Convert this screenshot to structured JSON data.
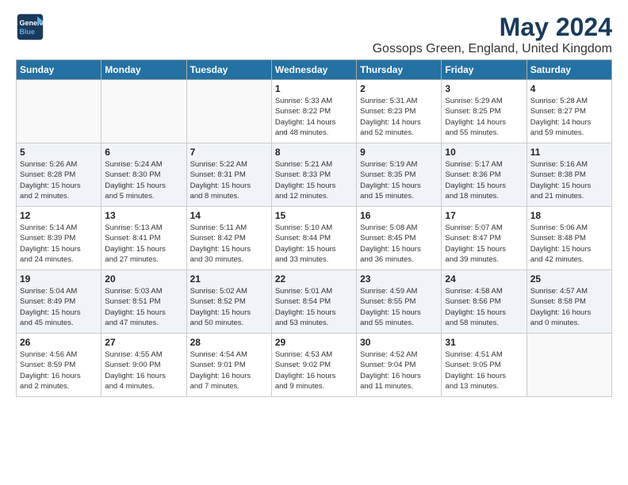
{
  "header": {
    "logo_line1": "General",
    "logo_line2": "Blue",
    "title": "May 2024",
    "subtitle": "Gossops Green, England, United Kingdom"
  },
  "days_of_week": [
    "Sunday",
    "Monday",
    "Tuesday",
    "Wednesday",
    "Thursday",
    "Friday",
    "Saturday"
  ],
  "weeks": [
    [
      {
        "day": "",
        "info": ""
      },
      {
        "day": "",
        "info": ""
      },
      {
        "day": "",
        "info": ""
      },
      {
        "day": "1",
        "info": "Sunrise: 5:33 AM\nSunset: 8:22 PM\nDaylight: 14 hours\nand 48 minutes."
      },
      {
        "day": "2",
        "info": "Sunrise: 5:31 AM\nSunset: 8:23 PM\nDaylight: 14 hours\nand 52 minutes."
      },
      {
        "day": "3",
        "info": "Sunrise: 5:29 AM\nSunset: 8:25 PM\nDaylight: 14 hours\nand 55 minutes."
      },
      {
        "day": "4",
        "info": "Sunrise: 5:28 AM\nSunset: 8:27 PM\nDaylight: 14 hours\nand 59 minutes."
      }
    ],
    [
      {
        "day": "5",
        "info": "Sunrise: 5:26 AM\nSunset: 8:28 PM\nDaylight: 15 hours\nand 2 minutes."
      },
      {
        "day": "6",
        "info": "Sunrise: 5:24 AM\nSunset: 8:30 PM\nDaylight: 15 hours\nand 5 minutes."
      },
      {
        "day": "7",
        "info": "Sunrise: 5:22 AM\nSunset: 8:31 PM\nDaylight: 15 hours\nand 8 minutes."
      },
      {
        "day": "8",
        "info": "Sunrise: 5:21 AM\nSunset: 8:33 PM\nDaylight: 15 hours\nand 12 minutes."
      },
      {
        "day": "9",
        "info": "Sunrise: 5:19 AM\nSunset: 8:35 PM\nDaylight: 15 hours\nand 15 minutes."
      },
      {
        "day": "10",
        "info": "Sunrise: 5:17 AM\nSunset: 8:36 PM\nDaylight: 15 hours\nand 18 minutes."
      },
      {
        "day": "11",
        "info": "Sunrise: 5:16 AM\nSunset: 8:38 PM\nDaylight: 15 hours\nand 21 minutes."
      }
    ],
    [
      {
        "day": "12",
        "info": "Sunrise: 5:14 AM\nSunset: 8:39 PM\nDaylight: 15 hours\nand 24 minutes."
      },
      {
        "day": "13",
        "info": "Sunrise: 5:13 AM\nSunset: 8:41 PM\nDaylight: 15 hours\nand 27 minutes."
      },
      {
        "day": "14",
        "info": "Sunrise: 5:11 AM\nSunset: 8:42 PM\nDaylight: 15 hours\nand 30 minutes."
      },
      {
        "day": "15",
        "info": "Sunrise: 5:10 AM\nSunset: 8:44 PM\nDaylight: 15 hours\nand 33 minutes."
      },
      {
        "day": "16",
        "info": "Sunrise: 5:08 AM\nSunset: 8:45 PM\nDaylight: 15 hours\nand 36 minutes."
      },
      {
        "day": "17",
        "info": "Sunrise: 5:07 AM\nSunset: 8:47 PM\nDaylight: 15 hours\nand 39 minutes."
      },
      {
        "day": "18",
        "info": "Sunrise: 5:06 AM\nSunset: 8:48 PM\nDaylight: 15 hours\nand 42 minutes."
      }
    ],
    [
      {
        "day": "19",
        "info": "Sunrise: 5:04 AM\nSunset: 8:49 PM\nDaylight: 15 hours\nand 45 minutes."
      },
      {
        "day": "20",
        "info": "Sunrise: 5:03 AM\nSunset: 8:51 PM\nDaylight: 15 hours\nand 47 minutes."
      },
      {
        "day": "21",
        "info": "Sunrise: 5:02 AM\nSunset: 8:52 PM\nDaylight: 15 hours\nand 50 minutes."
      },
      {
        "day": "22",
        "info": "Sunrise: 5:01 AM\nSunset: 8:54 PM\nDaylight: 15 hours\nand 53 minutes."
      },
      {
        "day": "23",
        "info": "Sunrise: 4:59 AM\nSunset: 8:55 PM\nDaylight: 15 hours\nand 55 minutes."
      },
      {
        "day": "24",
        "info": "Sunrise: 4:58 AM\nSunset: 8:56 PM\nDaylight: 15 hours\nand 58 minutes."
      },
      {
        "day": "25",
        "info": "Sunrise: 4:57 AM\nSunset: 8:58 PM\nDaylight: 16 hours\nand 0 minutes."
      }
    ],
    [
      {
        "day": "26",
        "info": "Sunrise: 4:56 AM\nSunset: 8:59 PM\nDaylight: 16 hours\nand 2 minutes."
      },
      {
        "day": "27",
        "info": "Sunrise: 4:55 AM\nSunset: 9:00 PM\nDaylight: 16 hours\nand 4 minutes."
      },
      {
        "day": "28",
        "info": "Sunrise: 4:54 AM\nSunset: 9:01 PM\nDaylight: 16 hours\nand 7 minutes."
      },
      {
        "day": "29",
        "info": "Sunrise: 4:53 AM\nSunset: 9:02 PM\nDaylight: 16 hours\nand 9 minutes."
      },
      {
        "day": "30",
        "info": "Sunrise: 4:52 AM\nSunset: 9:04 PM\nDaylight: 16 hours\nand 11 minutes."
      },
      {
        "day": "31",
        "info": "Sunrise: 4:51 AM\nSunset: 9:05 PM\nDaylight: 16 hours\nand 13 minutes."
      },
      {
        "day": "",
        "info": ""
      }
    ]
  ]
}
